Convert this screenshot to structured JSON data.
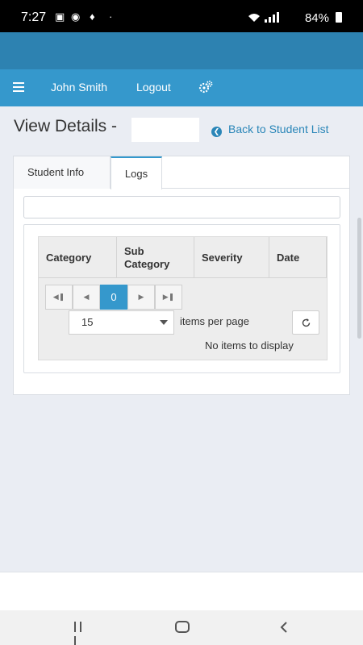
{
  "status_bar": {
    "time": "7:27",
    "battery": "84%"
  },
  "nav": {
    "user_name": "John Smith",
    "logout_label": "Logout"
  },
  "page": {
    "title": "View Details -",
    "back_link": "Back to Student List"
  },
  "tabs": [
    {
      "label": "Student Info",
      "active": false
    },
    {
      "label": "Logs",
      "active": true
    }
  ],
  "grid": {
    "columns": [
      "Category",
      "Sub Category",
      "Severity",
      "Date"
    ],
    "pager": {
      "current_page": "0"
    },
    "page_size": "15",
    "items_per_page_label": "items per page",
    "empty_message": "No items to display"
  },
  "colors": {
    "header_dark": "#2d82b1",
    "header": "#3598cc",
    "link": "#2a86b8",
    "background": "#eaedf3"
  }
}
